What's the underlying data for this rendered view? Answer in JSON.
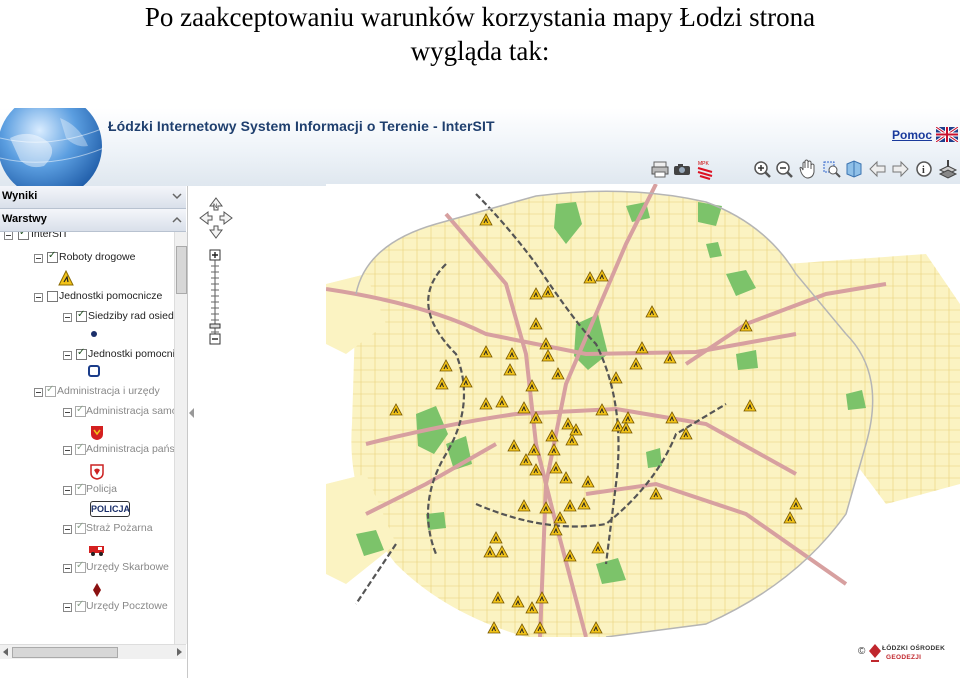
{
  "caption": {
    "line1": "Po zaakceptowaniu warunków korzystania mapy Łodzi strona",
    "line2": "wygląda tak:"
  },
  "header": {
    "title": "Łódzki Internetowy System Informacji o Terenie - InterSIT",
    "help_label": "Pomoc",
    "language_flag": "uk-flag-icon"
  },
  "toolbar": {
    "icons": [
      "print-icon",
      "camera-icon",
      "mpk-logo-icon",
      "zoom-in-icon",
      "zoom-out-icon",
      "pan-hand-icon",
      "zoom-select-icon",
      "zoom-extent-icon",
      "back-arrow-icon",
      "forward-arrow-icon",
      "info-icon",
      "layers-icon",
      "export-icon"
    ]
  },
  "panel": {
    "results_label": "Wyniki",
    "layers_label": "Warstwy",
    "tree": [
      {
        "label": "InterSIT",
        "checked": true,
        "dim": false
      },
      {
        "label": "Roboty drogowe",
        "checked": true,
        "dim": false
      },
      {
        "label": "Jednostki pomocnicze",
        "checked": false,
        "dim": false
      },
      {
        "label": "Siedziby rad osiedli",
        "checked": true,
        "dim": false
      },
      {
        "label": "Jednostki pomocnicze",
        "checked": true,
        "dim": false
      },
      {
        "label": "Administracja i urzędy",
        "checked": true,
        "dim": true
      },
      {
        "label": "Administracja samorządowa",
        "checked": true,
        "dim": true
      },
      {
        "label": "Administracja państwowa",
        "checked": true,
        "dim": true
      },
      {
        "label": "Policja",
        "checked": true,
        "dim": true
      },
      {
        "label": "Straż Pożarna",
        "checked": true,
        "dim": true
      },
      {
        "label": "Urzędy Skarbowe",
        "checked": true,
        "dim": true
      },
      {
        "label": "Urzędy Pocztowe",
        "checked": true,
        "dim": true
      }
    ],
    "police_badge": "POLICJA"
  },
  "navigation": {
    "north_label": "N"
  },
  "footer": {
    "copyright": "©",
    "org_line1": "ŁÓDZKI OŚRODEK",
    "org_line2": "GEODEZJI"
  },
  "colors": {
    "header_title": "#1f3f6e",
    "help_link": "#1a3a9c",
    "main_roads": "#d7a0a0",
    "railway": "#555555",
    "parks": "#7cc36a",
    "built_area": "#fbf3c2",
    "roadworks_sign": "#f2c318"
  }
}
